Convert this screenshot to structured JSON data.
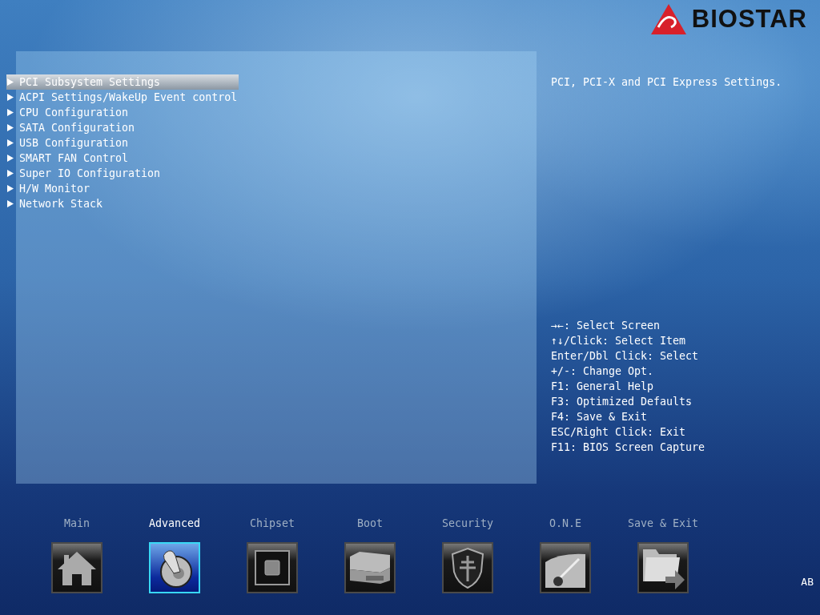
{
  "logo": {
    "text": "BIOSTAR"
  },
  "menu": [
    {
      "label": "PCI Subsystem Settings",
      "selected": true
    },
    {
      "label": "ACPI Settings/WakeUp Event control",
      "selected": false
    },
    {
      "label": "CPU Configuration",
      "selected": false
    },
    {
      "label": "SATA Configuration",
      "selected": false
    },
    {
      "label": "USB Configuration",
      "selected": false
    },
    {
      "label": "SMART FAN Control",
      "selected": false
    },
    {
      "label": "Super IO Configuration",
      "selected": false
    },
    {
      "label": "H/W Monitor",
      "selected": false
    },
    {
      "label": "Network Stack",
      "selected": false
    }
  ],
  "help": {
    "description": "PCI, PCI-X and PCI Express Settings.",
    "keys": [
      "→←: Select Screen",
      "↑↓/Click: Select Item",
      "Enter/Dbl Click: Select",
      "+/-: Change Opt.",
      "F1: General Help",
      "F3: Optimized Defaults",
      "F4: Save & Exit",
      "ESC/Right Click: Exit",
      "F11: BIOS Screen Capture"
    ]
  },
  "tabs": [
    {
      "label": "Main",
      "kind": "home",
      "selected": false
    },
    {
      "label": "Advanced",
      "kind": "toggle",
      "selected": true
    },
    {
      "label": "Chipset",
      "kind": "chip",
      "selected": false
    },
    {
      "label": "Boot",
      "kind": "drives",
      "selected": false
    },
    {
      "label": "Security",
      "kind": "shield",
      "selected": false
    },
    {
      "label": "O.N.E",
      "kind": "gauge",
      "selected": false
    },
    {
      "label": "Save & Exit",
      "kind": "folder",
      "selected": false
    }
  ],
  "status": {
    "text": "AB"
  }
}
